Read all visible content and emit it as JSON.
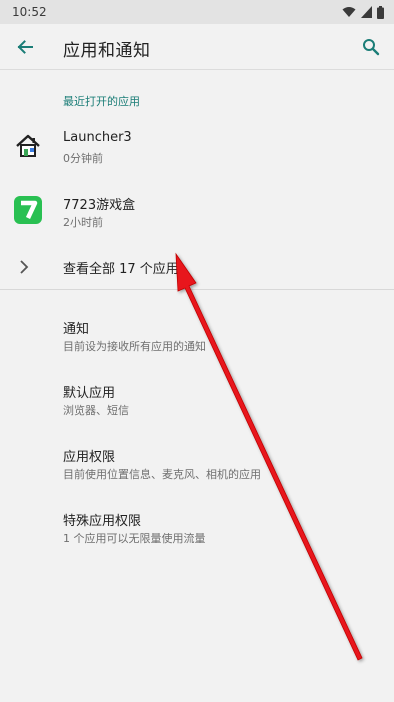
{
  "status_bar": {
    "time": "10:52"
  },
  "header": {
    "title": "应用和通知"
  },
  "recent": {
    "heading": "最近打开的应用",
    "apps": [
      {
        "name": "Launcher3",
        "time": "0分钟前",
        "icon": "home-icon"
      },
      {
        "name": "7723游戏盒",
        "time": "2小时前",
        "icon": "7723-app-icon"
      }
    ]
  },
  "see_all": {
    "label": "查看全部 17 个应用"
  },
  "settings": [
    {
      "title": "通知",
      "summary": "目前设为接收所有应用的通知"
    },
    {
      "title": "默认应用",
      "summary": "浏览器、短信"
    },
    {
      "title": "应用权限",
      "summary": "目前使用位置信息、麦克风、相机的应用"
    },
    {
      "title": "特殊应用权限",
      "summary": "1 个应用可以无限量使用流量"
    }
  ],
  "colors": {
    "accent": "#1b7d77",
    "arrow": "#e8171f",
    "background": "#f2f2f2"
  }
}
